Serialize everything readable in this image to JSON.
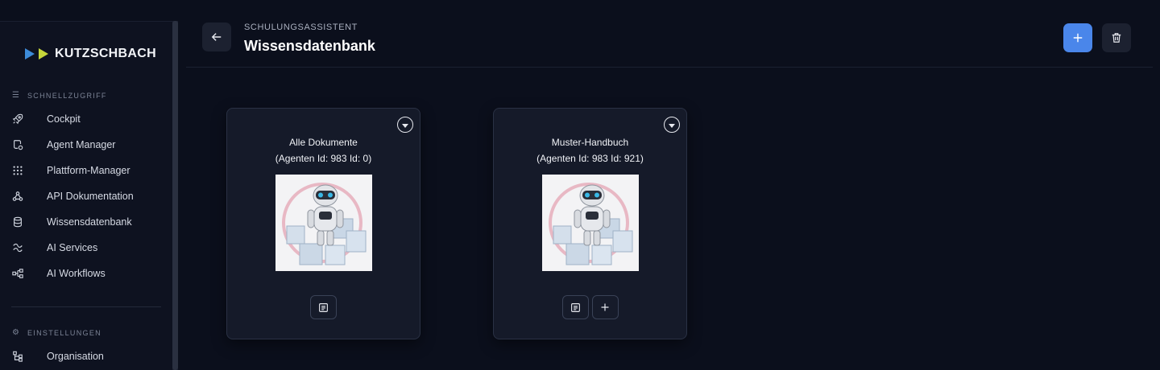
{
  "brand": {
    "name": "KUTZSCHBACH"
  },
  "sidebar": {
    "quick_access_label": "SCHNELLZUGRIFF",
    "items": [
      {
        "label": "Cockpit",
        "icon": "rocket-icon"
      },
      {
        "label": "Agent Manager",
        "icon": "agent-shield-icon"
      },
      {
        "label": "Plattform-Manager",
        "icon": "grid-dots-icon"
      },
      {
        "label": "API Dokumentation",
        "icon": "webhook-icon"
      },
      {
        "label": "Wissensdatenbank",
        "icon": "database-icon"
      },
      {
        "label": "AI Services",
        "icon": "ai-services-icon"
      },
      {
        "label": "AI Workflows",
        "icon": "workflow-icon"
      }
    ],
    "settings_label": "EINSTELLUNGEN",
    "settings_items": [
      {
        "label": "Organisation",
        "icon": "organisation-icon"
      }
    ]
  },
  "header": {
    "breadcrumb": "SCHULUNGSASSISTENT",
    "title": "Wissensdatenbank"
  },
  "cards": [
    {
      "title": "Alle Dokumente",
      "subtitle": "(Agenten Id: 983 Id: 0)",
      "actions": [
        "document-icon"
      ]
    },
    {
      "title": "Muster-Handbuch",
      "subtitle": "(Agenten Id: 983 Id: 921)",
      "actions": [
        "document-icon",
        "plus-icon"
      ]
    }
  ],
  "colors": {
    "accent": "#4a86ea",
    "logo_blue": "#3d8bd9",
    "logo_green": "#c6d63a",
    "background": "#0b0f1c"
  }
}
